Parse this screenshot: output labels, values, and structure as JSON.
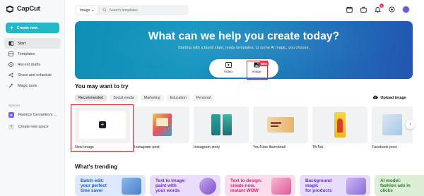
{
  "app": {
    "name": "CapCut"
  },
  "sidebar": {
    "create_label": "Create new",
    "items": [
      {
        "label": "Start",
        "icon": "home-icon",
        "active": true
      },
      {
        "label": "Templates",
        "icon": "templates-icon"
      },
      {
        "label": "Recent drafts",
        "icon": "clock-icon"
      },
      {
        "label": "Share and schedule",
        "icon": "share-icon"
      },
      {
        "label": "Magic tools",
        "icon": "magic-wand-icon"
      }
    ],
    "spaces_label": "Spaces",
    "space_name": "Ravince Cervantes's ...",
    "space_initial": "R",
    "create_space_label": "Create new space"
  },
  "topbar": {
    "search_category": "Image",
    "search_placeholder": "Search templates",
    "notification_count": "1"
  },
  "hero": {
    "title": "What can we help you create today?",
    "subtitle": "Starting with a blank slate, ready templates, or some AI magic, you choose.",
    "toggle_video": "Video",
    "toggle_image": "Image",
    "new_badge": "New"
  },
  "try_section": {
    "title": "You may want to try",
    "tabs": [
      "Recommended",
      "Social media",
      "Marketing",
      "Education",
      "Personal"
    ],
    "upload_label": "Upload image",
    "cards": [
      {
        "label": "New image"
      },
      {
        "label": "Instagram post"
      },
      {
        "label": "Instagram story"
      },
      {
        "label": "YouTube thumbnail"
      },
      {
        "label": "TikTok"
      },
      {
        "label": "Facebook post"
      }
    ]
  },
  "trending": {
    "title": "What's trending",
    "items": [
      {
        "line1": "Batch edit:",
        "line2": "your perfect",
        "line3": "time saver",
        "color": "#1f5fc8"
      },
      {
        "line1": "Text to image:",
        "line2": "paint with",
        "line3": "your words",
        "color": "#6a2fcf"
      },
      {
        "line1": "Text to design:",
        "line2": "create now,",
        "line3": "instant WOW",
        "color": "#d0246f"
      },
      {
        "line1": "Background",
        "line2": "magic",
        "line3": "for products",
        "color": "#6a2fcf"
      },
      {
        "line1": "AI model:",
        "line2": "fashion ads in",
        "line3": "clicks",
        "color": "#2f7a2f"
      }
    ]
  },
  "colors": {
    "accent": "#22b8c8",
    "highlight": "#e0262f"
  }
}
